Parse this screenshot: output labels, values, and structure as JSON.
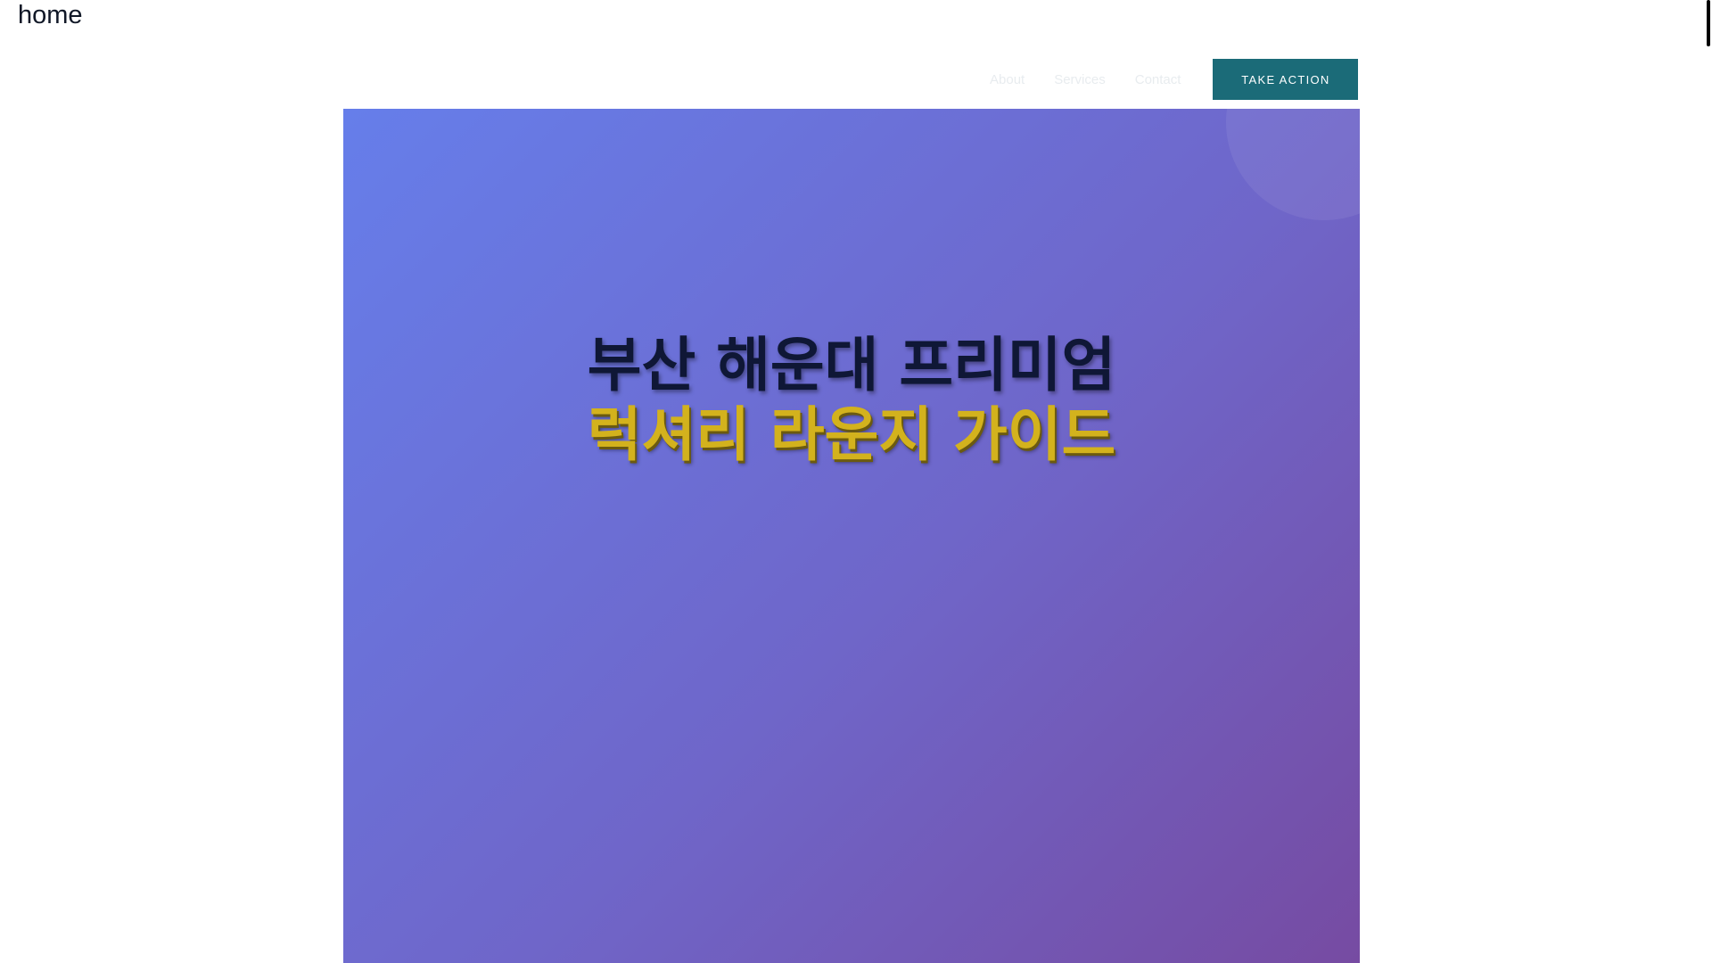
{
  "header": {
    "home_label": "home"
  },
  "nav": {
    "links": [
      {
        "label": "About"
      },
      {
        "label": "Services"
      },
      {
        "label": "Contact"
      }
    ],
    "cta_label": "TAKE ACTION"
  },
  "hero": {
    "title_line_1": "부산 해운대 프리미엄",
    "title_line_2": "럭셔리 라운지 가이드"
  },
  "colors": {
    "cta_background": "#1b6b78",
    "hero_gradient_start": "#667eea",
    "hero_gradient_end": "#764ba2",
    "title_primary": "#0f1736",
    "title_accent": "#d3b21d"
  }
}
